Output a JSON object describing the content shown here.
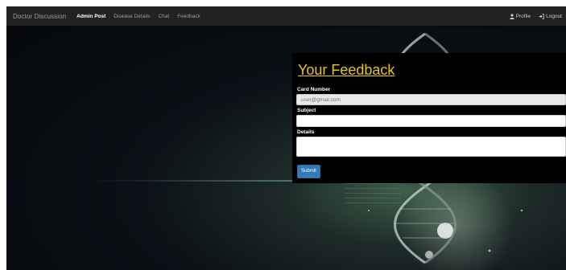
{
  "navbar": {
    "brand": "Doctor Discussion",
    "links": [
      {
        "label": "Admin Post",
        "active": true
      },
      {
        "label": "Disease Details",
        "active": false
      },
      {
        "label": "Chat",
        "active": false
      },
      {
        "label": "Feedback",
        "active": false
      }
    ],
    "right": [
      {
        "label": "Profile",
        "icon": "user-icon"
      },
      {
        "label": "Logout",
        "icon": "logout-icon"
      }
    ]
  },
  "feedback": {
    "title": "Your Feedback",
    "card_label": "Card Number",
    "card_value": "user@gmail.com",
    "subject_label": "Subject",
    "subject_value": "",
    "details_label": "Details",
    "details_value": "",
    "submit_label": "Submit"
  },
  "background": {
    "caption": "...."
  },
  "colors": {
    "navbar": "#222222",
    "title": "#e9c516",
    "button": "#337ab7"
  }
}
